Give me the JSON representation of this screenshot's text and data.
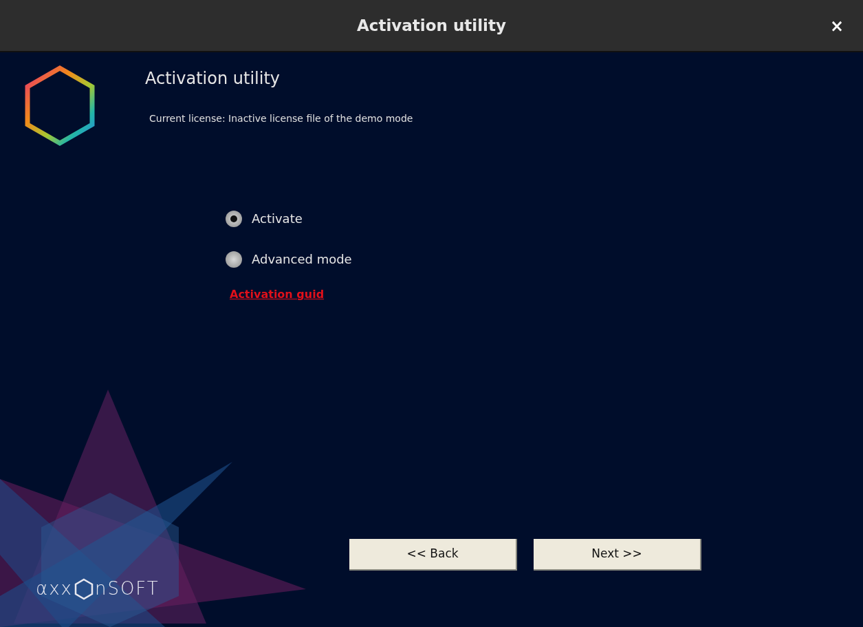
{
  "window": {
    "title": "Activation utility",
    "close": "×"
  },
  "header": {
    "title": "Activation utility",
    "license": "Current license: Inactive license file of the demo mode"
  },
  "options": [
    {
      "label": "Activate",
      "selected": true
    },
    {
      "label": "Advanced mode",
      "selected": false
    }
  ],
  "link": "Activation guid",
  "buttons": [
    "<< Back",
    "Next >>"
  ],
  "logo": {
    "before": "αxx",
    "after": "nSOFT"
  }
}
